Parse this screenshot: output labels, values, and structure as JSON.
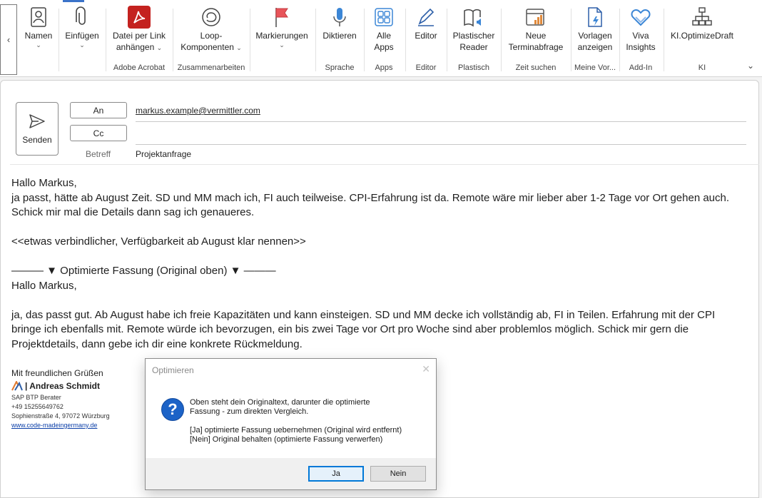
{
  "ribbon": {
    "buttons": {
      "names": "Namen",
      "attach": "Einfügen",
      "acrobat_line1": "Datei per Link",
      "acrobat_line2": "anhängen",
      "loop_line1": "Loop-",
      "loop_line2": "Komponenten",
      "flags": "Markierungen",
      "dictate": "Diktieren",
      "apps_line1": "Alle",
      "apps_line2": "Apps",
      "editor": "Editor",
      "reader_line1": "Plastischer",
      "reader_line2": "Reader",
      "poll_line1": "Neue",
      "poll_line2": "Terminabfrage",
      "templates_line1": "Vorlagen",
      "templates_line2": "anzeigen",
      "viva_line1": "Viva",
      "viva_line2": "Insights",
      "ki": "KI.OptimizeDraft"
    },
    "groups": {
      "acrobat": "Adobe Acrobat",
      "collab": "Zusammenarbeiten",
      "speech": "Sprache",
      "apps": "Apps",
      "editor": "Editor",
      "immersive": "Plastisch",
      "time": "Zeit suchen",
      "mine": "Meine Vor...",
      "addin": "Add-In",
      "ki": "KI"
    }
  },
  "compose": {
    "send_label": "Senden",
    "to_label": "An",
    "cc_label": "Cc",
    "subject_label": "Betreff",
    "to_value": "markus.example@vermittler.com",
    "subject_value": "Projektanfrage"
  },
  "body": {
    "greeting1": "Hallo Markus,",
    "original_line1": "ja passt, hätte ab August Zeit. SD und MM mach ich, FI auch teilweise. CPI-Erfahrung ist da. Remote wäre mir lieber aber 1-2 Tage vor Ort gehen auch.",
    "original_line2": "Schick mir mal die Details dann sag ich genaueres.",
    "instruction": "<<etwas verbindlicher, Verfügbarkeit ab August klar nennen>>",
    "separator": "——— ▼ Optimierte Fassung (Original oben) ▼ ———",
    "greeting2": "Hallo Markus,",
    "optimized_line1": "ja, das passt gut. Ab August habe ich freie Kapazitäten und kann einsteigen. SD und MM decke ich vollständig ab, FI in Teilen. Erfahrung mit der CPI",
    "optimized_line2": "bringe ich ebenfalls mit. Remote würde ich bevorzugen, ein bis zwei Tage vor Ort pro Woche sind aber problemlos möglich. Schick mir gern die",
    "optimized_line3": "Projektdetails, dann gebe ich dir eine konkrete Rückmeldung."
  },
  "signature": {
    "greeting": "Mit freundlichen Grüßen",
    "name": "| Andreas Schmidt",
    "role": "SAP BTP Berater",
    "phone": "+49 15255649762",
    "address": "Sophienstraße 4, 97072 Würzburg",
    "website": "www.code-madeingermany.de"
  },
  "dialog": {
    "title": "Optimieren",
    "message_line1": "Oben steht dein Originaltext, darunter die optimierte",
    "message_line2": "Fassung - zum direkten Vergleich.",
    "option_yes_text": "[Ja] optimierte Fassung uebernehmen (Original wird entfernt)",
    "option_no_text": "[Nein] Original behalten (optimierte Fassung verwerfen)",
    "yes_button": "Ja",
    "no_button": "Nein"
  },
  "colors": {
    "accent": "#3b73c9",
    "acrobat_red": "#c4221f",
    "question_blue": "#1c63c7"
  }
}
